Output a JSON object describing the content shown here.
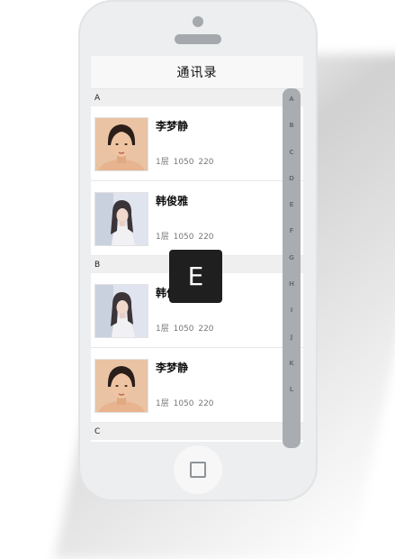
{
  "navbar": {
    "title": "通讯录"
  },
  "sections": [
    {
      "letter": "A",
      "contacts": [
        {
          "name": "李梦静",
          "info": "1层 1050 220",
          "avatar": "short-hair-woman"
        },
        {
          "name": "韩俊雅",
          "info": "1层 1050 220",
          "avatar": "long-hair-woman"
        }
      ]
    },
    {
      "letter": "B",
      "contacts": [
        {
          "name": "韩俊雅",
          "info": "1层 1050 220",
          "avatar": "long-hair-woman"
        },
        {
          "name": "李梦静",
          "info": "1层 1050 220",
          "avatar": "short-hair-woman"
        }
      ]
    },
    {
      "letter": "C",
      "contacts": []
    }
  ],
  "index_letters": [
    "A",
    "B",
    "C",
    "D",
    "E",
    "F",
    "G",
    "H",
    "I",
    "J",
    "K",
    "L"
  ],
  "popup_letter": "E",
  "colors": {
    "index_bar": "#a9adb2",
    "popup_bg": "#1f1f1f",
    "phone_body": "#eceeef"
  }
}
